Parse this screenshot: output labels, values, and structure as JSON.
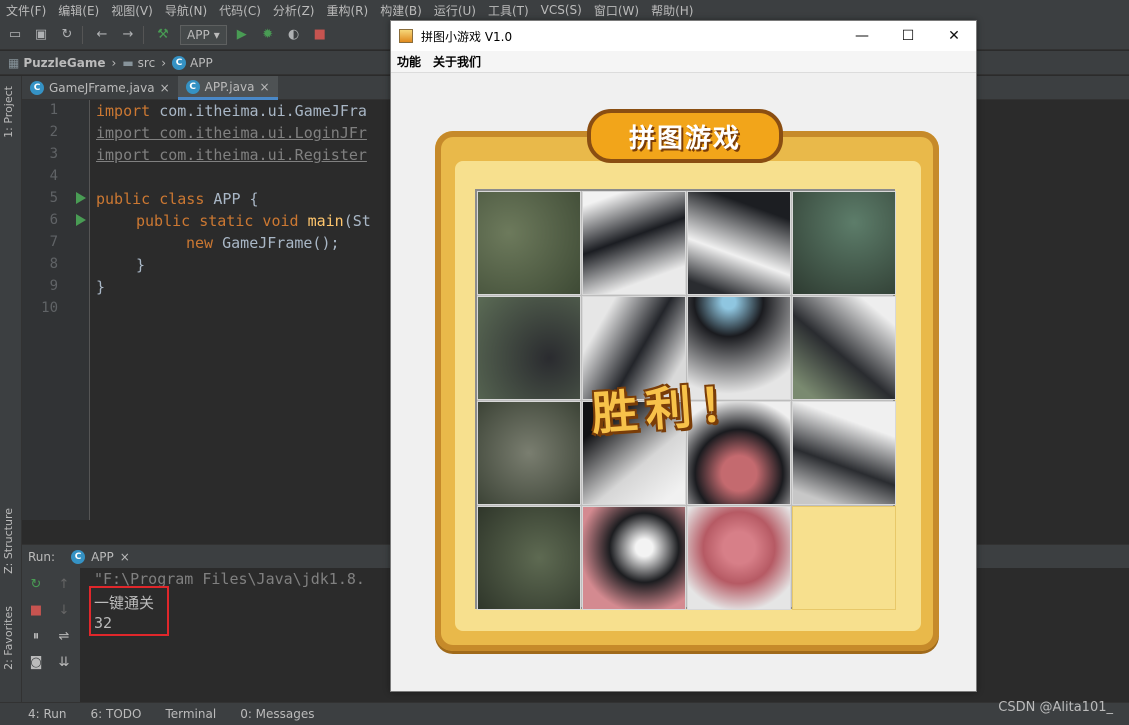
{
  "ide": {
    "menu": [
      "文件(F)",
      "编辑(E)",
      "视图(V)",
      "导航(N)",
      "代码(C)",
      "分析(Z)",
      "重构(R)",
      "构建(B)",
      "运行(U)",
      "工具(T)",
      "VCS(S)",
      "窗口(W)",
      "帮助(H)"
    ],
    "run_config": "APP",
    "breadcrumb": {
      "project": "PuzzleGame",
      "folder": "src",
      "file": "APP"
    },
    "tabs": [
      {
        "label": "GameJFrame.java",
        "active": false
      },
      {
        "label": "APP.java",
        "active": true
      }
    ],
    "side_labels": {
      "project": "1: Project",
      "structure": "Z: Structure",
      "favorites": "2: Favorites"
    },
    "line_numbers": [
      "1",
      "2",
      "3",
      "4",
      "5",
      "6",
      "7",
      "8",
      "9",
      "10"
    ],
    "code": {
      "l1_kw": "import ",
      "l1": "com.itheima.ui.GameJFra",
      "l2": "import com.itheima.ui.LoginJFr",
      "l3": "import com.itheima.ui.Register",
      "l5_kw": "public class ",
      "l5": "APP {",
      "l6_kw": "public static void ",
      "l6_fn": "main",
      "l6": "(St",
      "l7_kw": "new ",
      "l7": "GameJFrame();",
      "l8": "}",
      "l9": "}"
    },
    "run_panel": {
      "label": "Run:",
      "tab": "APP",
      "console": [
        "\"F:\\Program Files\\Java\\jdk1.8.",
        "一键通关",
        "32"
      ]
    },
    "statusbar": [
      "4: Run",
      "6: TODO",
      "Terminal",
      "0: Messages"
    ],
    "watermark": "CSDN @Alita101_"
  },
  "game": {
    "title": "拼图小游戏 V1.0",
    "menu": [
      "功能",
      "关于我们"
    ],
    "logo": "拼图游戏",
    "win_text": "胜利！",
    "grid": {
      "rows": 4,
      "cols": 4,
      "empty_index": 15
    }
  },
  "colors": {
    "accent": "#4a88c7",
    "highlight": "#e0272b",
    "run_green": "#499c54"
  }
}
